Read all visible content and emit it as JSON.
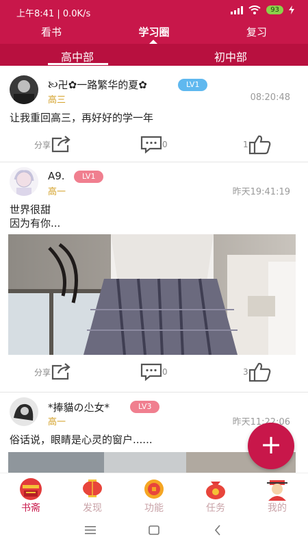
{
  "status_bar": {
    "time": "上午8:41",
    "speed": "0.0K/s",
    "battery": "93"
  },
  "top_tabs": [
    "看书",
    "学习圈",
    "复习"
  ],
  "sub_tabs": [
    "高中部",
    "初中部"
  ],
  "posts": [
    {
      "username": "🙠卍✿一路繁华的夏✿",
      "level": "LV1",
      "level_color": "#5fb8ef",
      "grade": "高三",
      "time": "08:20:48",
      "text": "让我重回高三，再好好的学一年",
      "share_label": "分享",
      "comments": "0",
      "likes": "1"
    },
    {
      "username": "A9.",
      "level": "LV1",
      "level_color": "#f07f8f",
      "grade": "高一",
      "time": "昨天19:41:19",
      "text": "世界很甜\n因为有你...",
      "share_label": "分享",
      "comments": "0",
      "likes": "3"
    },
    {
      "username": "*捧貓の尐女*",
      "level": "LV3",
      "level_color": "#f07f8f",
      "grade": "高一",
      "time": "昨天11:22:06",
      "text": "俗话说，眼睛是心灵的窗户......"
    }
  ],
  "fab_label": "+",
  "bottom_nav": [
    "书斋",
    "发现",
    "功能",
    "任务",
    "我的"
  ],
  "colors": {
    "brand": "#c8174a",
    "grade": "#d4a22a",
    "nav_inactive": "#c9a3a8"
  }
}
